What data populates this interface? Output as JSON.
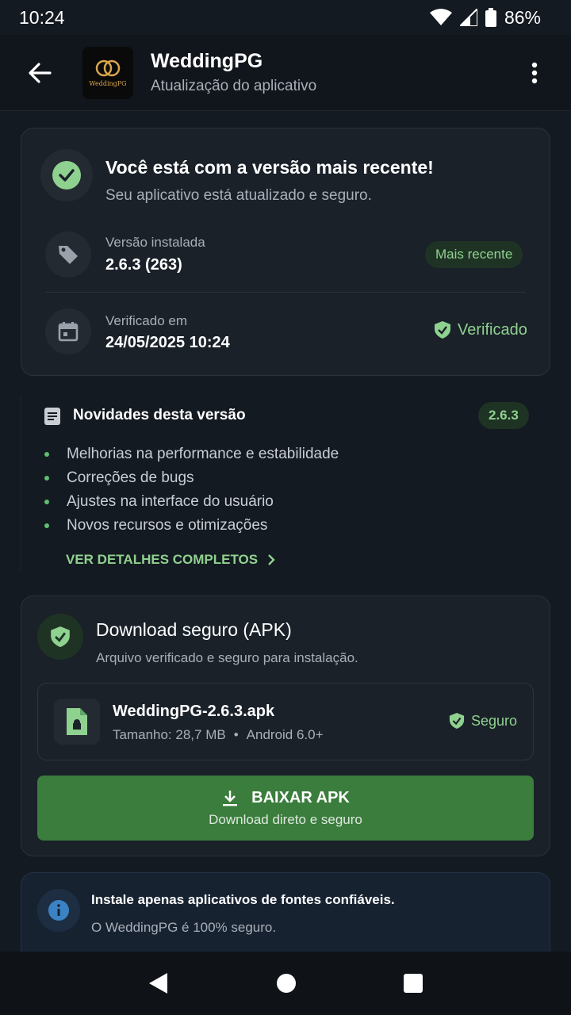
{
  "status_bar": {
    "time": "10:24",
    "battery": "86%"
  },
  "header": {
    "app_name": "WeddingPG",
    "subtitle": "Atualização do aplicativo",
    "logo_text": "WeddingPG"
  },
  "status_card": {
    "title": "Você está com a versão mais recente!",
    "subtitle": "Seu aplicativo está atualizado e seguro.",
    "installed_label": "Versão instalada",
    "installed_value": "2.6.3 (263)",
    "latest_badge": "Mais recente",
    "checked_label": "Verificado em",
    "checked_value": "24/05/2025 10:24",
    "verified_label": "Verificado"
  },
  "whats_new": {
    "title": "Novidades desta versão",
    "version_badge": "2.6.3",
    "items": [
      "Melhorias na performance e estabilidade",
      "Correções de bugs",
      "Ajustes na interface do usuário",
      "Novos recursos e otimizações"
    ],
    "details_link": "VER DETALHES COMPLETOS"
  },
  "download_card": {
    "title": "Download seguro (APK)",
    "subtitle": "Arquivo verificado e seguro para instalação.",
    "file_name": "WeddingPG-2.6.3.apk",
    "file_size": "Tamanho: 28,7 MB",
    "separator": "•",
    "android_req": "Android 6.0+",
    "safe_label": "Seguro",
    "button_label": "BAIXAR APK",
    "button_sub": "Download direto e seguro"
  },
  "info_card": {
    "line1": "Instale apenas aplicativos de fontes confiáveis.",
    "line2": "O WeddingPG é 100% seguro."
  },
  "colors": {
    "accent_green": "#8fd18f",
    "button_green": "#3a7d3c",
    "info_blue": "#3b82c4"
  }
}
